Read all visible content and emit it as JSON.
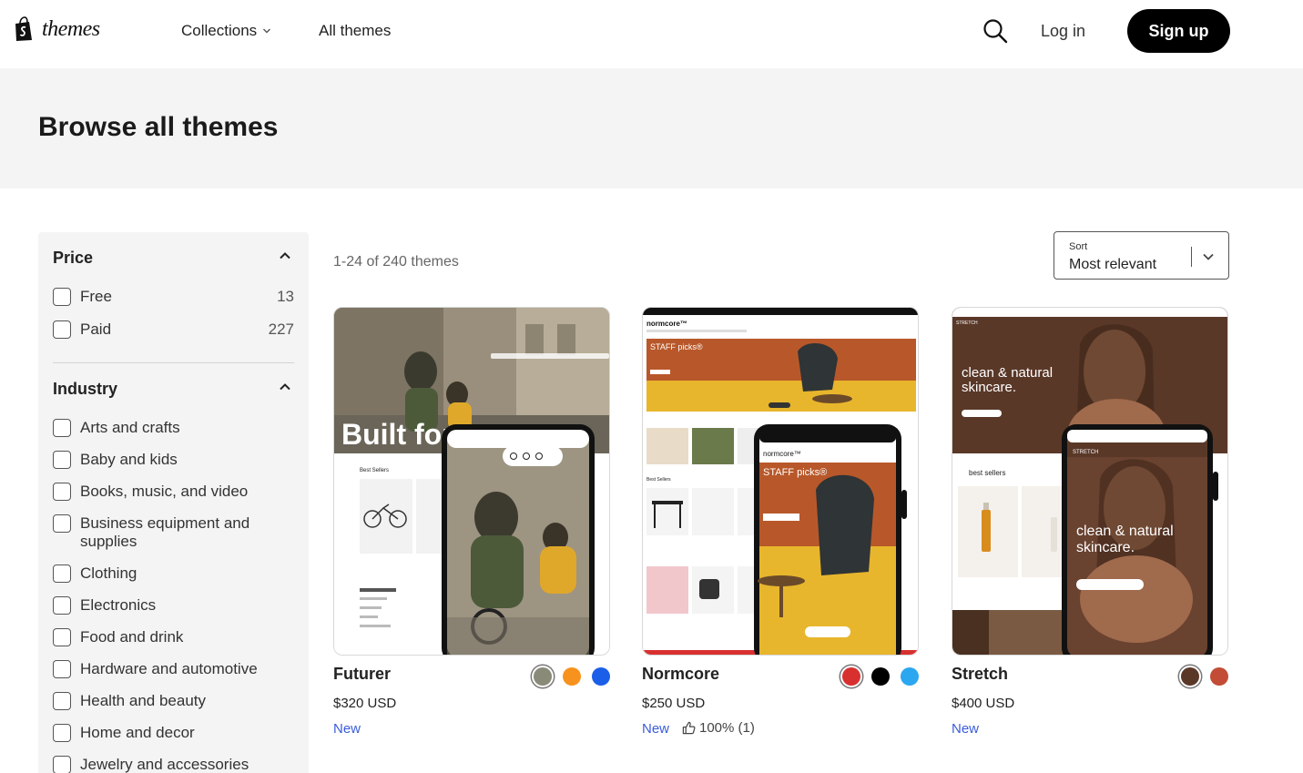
{
  "header": {
    "logo_text": "themes",
    "nav": [
      {
        "label": "Collections"
      },
      {
        "label": "All themes"
      }
    ],
    "login_label": "Log in",
    "signup_label": "Sign up"
  },
  "banner": {
    "title": "Browse all themes"
  },
  "filters": {
    "price": {
      "title": "Price",
      "options": [
        {
          "label": "Free",
          "count": "13"
        },
        {
          "label": "Paid",
          "count": "227"
        }
      ]
    },
    "industry": {
      "title": "Industry",
      "options": [
        {
          "label": "Arts and crafts"
        },
        {
          "label": "Baby and kids"
        },
        {
          "label": "Books, music, and video"
        },
        {
          "label": "Business equipment and supplies"
        },
        {
          "label": "Clothing"
        },
        {
          "label": "Electronics"
        },
        {
          "label": "Food and drink"
        },
        {
          "label": "Hardware and automotive"
        },
        {
          "label": "Health and beauty"
        },
        {
          "label": "Home and decor"
        },
        {
          "label": "Jewelry and accessories"
        }
      ]
    }
  },
  "results": {
    "count_text": "1-24 of 240 themes"
  },
  "sort": {
    "label": "Sort",
    "value": "Most relevant"
  },
  "themes": [
    {
      "name": "Futurer",
      "price": "$320 USD",
      "badge": "New",
      "preview_headline": "Built for",
      "preview_section": "Best Sellers",
      "swatches": [
        "#8a8a78",
        "#f7921e",
        "#1b5ee8"
      ]
    },
    {
      "name": "Normcore",
      "price": "$250 USD",
      "badge": "New",
      "rating": "100% (1)",
      "preview_brand": "normcore™",
      "preview_headline": "STAFF picks®",
      "preview_section": "Best Sellers",
      "swatches": [
        "#d8302f",
        "#000000",
        "#2ba7f0"
      ]
    },
    {
      "name": "Stretch",
      "price": "$400 USD",
      "badge": "New",
      "preview_headline_1": "clean & natural",
      "preview_headline_2": "skincare.",
      "preview_brand": "STRETCH",
      "preview_section": "best sellers",
      "swatches": [
        "#5a3828",
        "#c24c36"
      ]
    }
  ]
}
